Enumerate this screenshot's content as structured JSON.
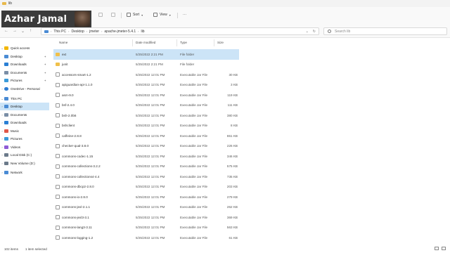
{
  "window": {
    "title": "lib"
  },
  "overlay": {
    "name": "Azhar Jamal"
  },
  "toolbar": {
    "sort_label": "Sort",
    "view_label": "View",
    "more_label": "···"
  },
  "address": {
    "crumbs": [
      "This PC",
      "Desktop",
      "jmeter",
      "apache-jmeter-5.4.1",
      "lib"
    ],
    "search_placeholder": "Search lib"
  },
  "sidebar": {
    "items": [
      {
        "label": "Quick access",
        "icon": "star-icon",
        "color": "#f2b600",
        "expand": "v"
      },
      {
        "label": "Desktop",
        "icon": "desktop-icon",
        "color": "#4a8bd4",
        "pinned": true
      },
      {
        "label": "Downloads",
        "icon": "download-icon",
        "color": "#2a7fd4",
        "pinned": true
      },
      {
        "label": "Documents",
        "icon": "document-icon",
        "color": "#7a8ea6",
        "pinned": true
      },
      {
        "label": "Pictures",
        "icon": "picture-icon",
        "color": "#3a9ad9",
        "pinned": true
      },
      {
        "label": "OneDrive - Personal",
        "icon": "cloud-icon",
        "color": "#2f7dd3",
        "expand": ">"
      },
      {
        "label": "This PC",
        "icon": "pc-icon",
        "color": "#4a8bd4",
        "expand": "v"
      },
      {
        "label": "Desktop",
        "icon": "desktop-icon",
        "color": "#4a8bd4",
        "expand": ">",
        "active": true
      },
      {
        "label": "Documents",
        "icon": "document-icon",
        "color": "#7a8ea6",
        "expand": ">"
      },
      {
        "label": "Downloads",
        "icon": "download-icon",
        "color": "#2a7fd4",
        "expand": ">"
      },
      {
        "label": "Music",
        "icon": "music-icon",
        "color": "#e0584a",
        "expand": ">"
      },
      {
        "label": "Pictures",
        "icon": "picture-icon",
        "color": "#3a9ad9",
        "expand": ">"
      },
      {
        "label": "Videos",
        "icon": "video-icon",
        "color": "#8e5bd6",
        "expand": ">"
      },
      {
        "label": "Local Disk (C:)",
        "icon": "drive-icon",
        "color": "#6b7a8a",
        "expand": ">"
      },
      {
        "label": "New Volume (D:)",
        "icon": "drive-icon",
        "color": "#6b7a8a",
        "expand": ">"
      },
      {
        "label": "Network",
        "icon": "network-icon",
        "color": "#4a8bd4",
        "expand": ">"
      }
    ]
  },
  "columns": {
    "name": "Name",
    "date": "Date modified",
    "type": "Type",
    "size": "Size"
  },
  "files": [
    {
      "name": "ext",
      "date": "5/25/2022 2:21 PM",
      "type": "File folder",
      "size": "",
      "kind": "folder",
      "selected": true
    },
    {
      "name": "junit",
      "date": "5/25/2022 2:21 PM",
      "type": "File folder",
      "size": "",
      "kind": "folder"
    },
    {
      "name": "accessors-smart-1.2",
      "date": "5/25/2022 12:01 PM",
      "type": "Executable Jar File",
      "size": "30 KB",
      "kind": "jar"
    },
    {
      "name": "apiguardian-api-1.1.0",
      "date": "5/25/2022 12:01 PM",
      "type": "Executable Jar File",
      "size": "3 KB",
      "kind": "jar"
    },
    {
      "name": "asm-9.0",
      "date": "5/25/2022 12:01 PM",
      "type": "Executable Jar File",
      "size": "119 KB",
      "kind": "jar"
    },
    {
      "name": "bsf-2.4.0",
      "date": "5/25/2022 12:01 PM",
      "type": "Executable Jar File",
      "size": "111 KB",
      "kind": "jar"
    },
    {
      "name": "bsh-2.0b6",
      "date": "5/25/2022 12:01 PM",
      "type": "Executable Jar File",
      "size": "380 KB",
      "kind": "jar"
    },
    {
      "name": "bshclient",
      "date": "5/25/2022 12:01 PM",
      "type": "Executable Jar File",
      "size": "8 KB",
      "kind": "jar"
    },
    {
      "name": "caffeine-2.8.8",
      "date": "5/25/2022 12:01 PM",
      "type": "Executable Jar File",
      "size": "861 KB",
      "kind": "jar"
    },
    {
      "name": "checker-qual-3.8.0",
      "date": "5/25/2022 12:01 PM",
      "type": "Executable Jar File",
      "size": "226 KB",
      "kind": "jar"
    },
    {
      "name": "commons-codec-1.15",
      "date": "5/25/2022 12:01 PM",
      "type": "Executable Jar File",
      "size": "346 KB",
      "kind": "jar"
    },
    {
      "name": "commons-collections-3.2.2",
      "date": "5/25/2022 12:01 PM",
      "type": "Executable Jar File",
      "size": "575 KB",
      "kind": "jar"
    },
    {
      "name": "commons-collections4-4.4",
      "date": "5/25/2022 12:01 PM",
      "type": "Executable Jar File",
      "size": "735 KB",
      "kind": "jar"
    },
    {
      "name": "commons-dbcp2-2.8.0",
      "date": "5/25/2022 12:01 PM",
      "type": "Executable Jar File",
      "size": "203 KB",
      "kind": "jar"
    },
    {
      "name": "commons-io-2.8.0",
      "date": "5/25/2022 12:01 PM",
      "type": "Executable Jar File",
      "size": "279 KB",
      "kind": "jar"
    },
    {
      "name": "commons-jexl-2.1.1",
      "date": "5/25/2022 12:01 PM",
      "type": "Executable Jar File",
      "size": "262 KB",
      "kind": "jar"
    },
    {
      "name": "commons-jexl3-3.1",
      "date": "5/25/2022 12:01 PM",
      "type": "Executable Jar File",
      "size": "369 KB",
      "kind": "jar"
    },
    {
      "name": "commons-lang3-3.11",
      "date": "5/25/2022 12:01 PM",
      "type": "Executable Jar File",
      "size": "563 KB",
      "kind": "jar"
    },
    {
      "name": "commons-logging-1.2",
      "date": "5/25/2022 12:01 PM",
      "type": "Executable Jar File",
      "size": "61 KB",
      "kind": "jar"
    }
  ],
  "status": {
    "count": "102 items",
    "selection": "1 item selected"
  }
}
